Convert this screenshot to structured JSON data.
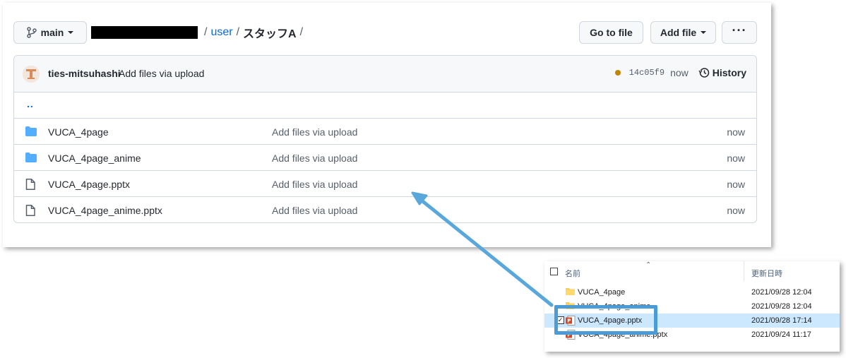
{
  "github": {
    "branch": "main",
    "breadcrumb": {
      "sep1": "/",
      "user": "user",
      "sep2": "/",
      "folder": "スタッフA",
      "sep3": "/"
    },
    "buttons": {
      "go_to_file": "Go to file",
      "add_file": "Add file",
      "more": "···"
    },
    "commit": {
      "author": "ties-mitsuhashi",
      "message": "Add files via upload",
      "sha": "14c05f9",
      "time": "now",
      "history": "History",
      "status_color": "#bf8700"
    },
    "parent_dir": "..",
    "files": [
      {
        "name": "VUCA_4page",
        "type": "folder",
        "message": "Add files via upload",
        "age": "now"
      },
      {
        "name": "VUCA_4page_anime",
        "type": "folder",
        "message": "Add files via upload",
        "age": "now"
      },
      {
        "name": "VUCA_4page.pptx",
        "type": "file",
        "message": "Add files via upload",
        "age": "now"
      },
      {
        "name": "VUCA_4page_anime.pptx",
        "type": "file",
        "message": "Add files via upload",
        "age": "now"
      }
    ]
  },
  "explorer": {
    "headers": {
      "name": "名前",
      "date": "更新日時"
    },
    "rows": [
      {
        "name": "VUCA_4page",
        "type": "folder",
        "date": "2021/09/28 12:04"
      },
      {
        "name": "VUCA_4page_anime",
        "type": "folder",
        "date": "2021/09/28 12:04"
      },
      {
        "name": "VUCA_4page.pptx",
        "type": "pptx",
        "date": "2021/09/28 17:14",
        "selected": true
      },
      {
        "name": "VUCA_4page_anime.pptx",
        "type": "pptx",
        "date": "2021/09/24 11:17"
      }
    ]
  },
  "colors": {
    "accent": "#0969da",
    "folder": "#54aeff",
    "highlight": "#4a9bd6",
    "selection": "#cce8ff"
  }
}
